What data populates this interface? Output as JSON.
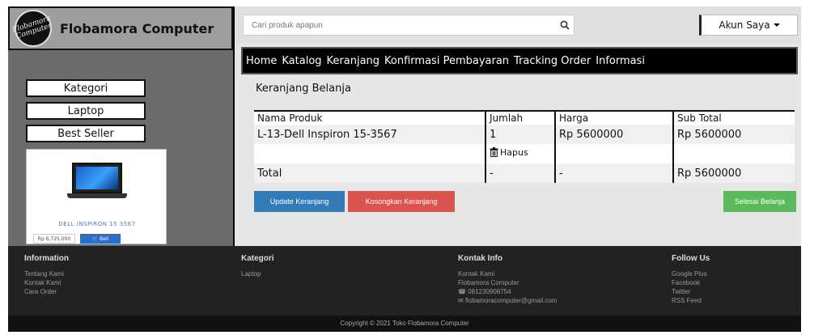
{
  "brand": {
    "name": "Flobamora Computer",
    "logo_text": "Flobamora Computer"
  },
  "sidebar": {
    "buttons": [
      "Kategori",
      "Laptop",
      "Best Seller"
    ],
    "product": {
      "name": "DELL INSPIRON 15 3567",
      "price": "Rp 6,725,000",
      "buy_label": "Beli"
    }
  },
  "header": {
    "search_placeholder": "Cari produk apapun",
    "search_icon": "search-icon",
    "account_label": "Akun Saya"
  },
  "nav": [
    "Home",
    "Katalog",
    "Keranjang",
    "Konfirmasi Pembayaran",
    "Tracking Order",
    "Informasi"
  ],
  "cart": {
    "title": "Keranjang Belanja",
    "columns": [
      "Nama Produk",
      "Jumlah",
      "Harga",
      "Sub Total"
    ],
    "item": {
      "name": "L-13-Dell Inspiron 15-3567",
      "qty": "1",
      "price": "Rp 5600000",
      "subtotal": "Rp 5600000"
    },
    "delete_label": "Hapus",
    "total_label": "Total",
    "total_qty": "-",
    "total_price": "-",
    "total_value": "Rp 5600000"
  },
  "actions": {
    "update": "Update Keranjang",
    "empty": "Kosongkan Keranjang",
    "finish": "Selesai Belanja"
  },
  "footer": {
    "information": {
      "title": "Information",
      "items": [
        "Tentang Kami",
        "Kontak Kami",
        "Cara Order"
      ]
    },
    "kategori": {
      "title": "Kategori",
      "items": [
        "Laptop"
      ]
    },
    "kontak": {
      "title": "Kontak Info",
      "items": [
        "Kontak Kami",
        "Flobamora Computer",
        "081230908754",
        "flobamoracomputer@gmail.com"
      ]
    },
    "follow": {
      "title": "Follow Us",
      "items": [
        "Google Plus",
        "Facebook",
        "Twitter",
        "RSS Feed"
      ]
    },
    "copyright": "Copyright © 2021 Toko Flobamora Computer"
  },
  "colors": {
    "primary": "#337ab7",
    "danger": "#d9534f",
    "success": "#5cb85c",
    "footer": "#222222"
  }
}
